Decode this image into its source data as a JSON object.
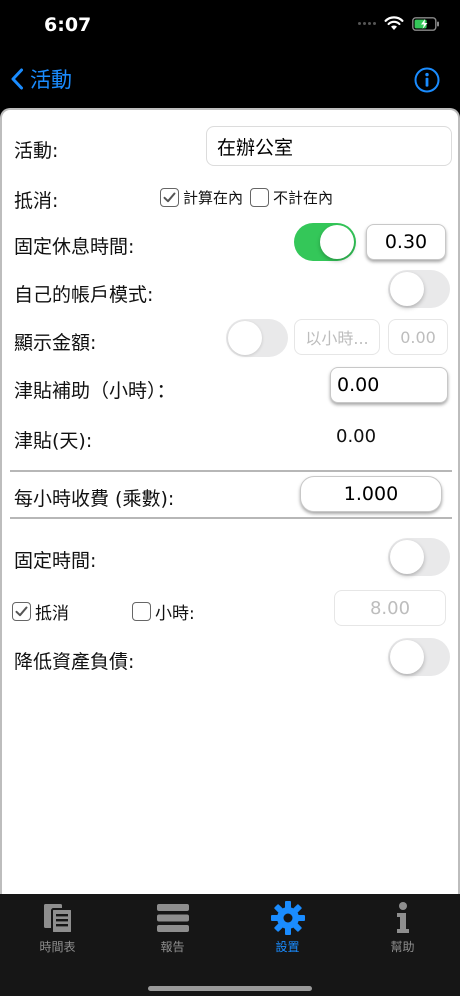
{
  "status": {
    "time": "6:07"
  },
  "nav": {
    "back_label": "活動"
  },
  "form": {
    "activity": {
      "label": "活動:",
      "value": "在辦公室"
    },
    "offset": {
      "label": "抵消:",
      "include_label": "計算在內",
      "include_checked": true,
      "exclude_label": "不計在內",
      "exclude_checked": false
    },
    "fixed_break": {
      "label": "固定休息時間:",
      "enabled": true,
      "value": "0.30"
    },
    "own_account": {
      "label": "自己的帳戶模式:",
      "enabled": false
    },
    "show_amount": {
      "label": "顯示金額:",
      "enabled": false,
      "mode": "以小時...",
      "value": "0.00"
    },
    "allowance_hours": {
      "label": "津貼補助（小時）：",
      "value": "0.00"
    },
    "allowance_days": {
      "label": "津貼(天):",
      "value": "0.00"
    },
    "hourly_rate": {
      "label": "每小時收費 (乘數):",
      "value": "1.000"
    },
    "fixed_time": {
      "label": "固定時間:",
      "enabled": false,
      "offset_label": "抵消",
      "offset_checked": true,
      "hours_label": "小時:",
      "hours_checked": false,
      "hours_value": "8.00"
    },
    "reduce_liability": {
      "label": "降低資產負債:",
      "enabled": false
    }
  },
  "tabs": [
    {
      "label": "時間表",
      "icon": "timesheet-icon",
      "active": false
    },
    {
      "label": "報告",
      "icon": "report-icon",
      "active": false
    },
    {
      "label": "設置",
      "icon": "gear-icon",
      "active": true
    },
    {
      "label": "幫助",
      "icon": "info-icon",
      "active": false
    }
  ],
  "colors": {
    "accent": "#1a8cff",
    "toggle_on": "#34c759"
  }
}
